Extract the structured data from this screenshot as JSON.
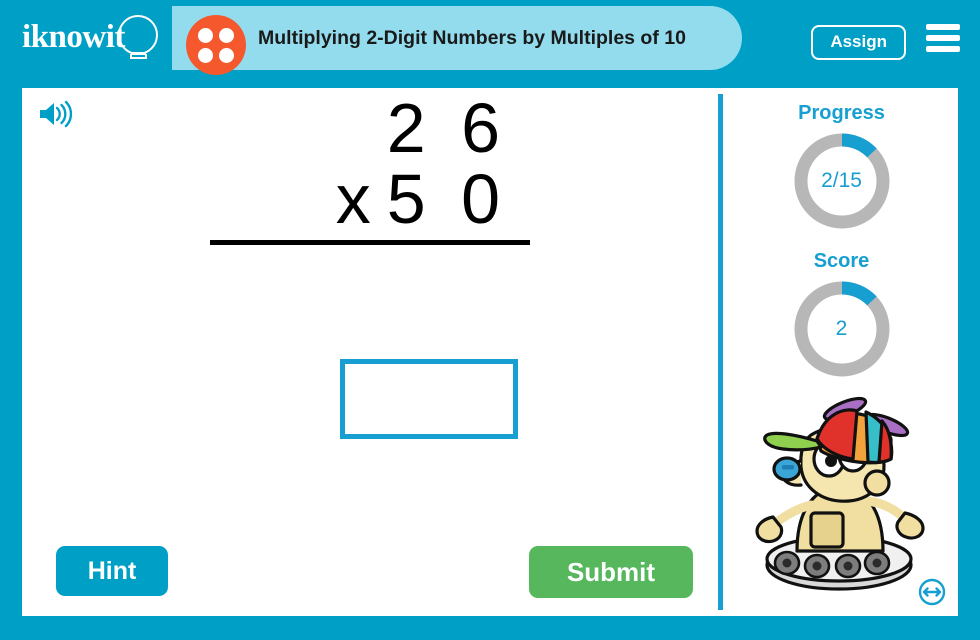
{
  "header": {
    "logo_text": "iknowit",
    "logo_icon": "lightbulb-icon",
    "lesson_icon": "four-dot-dice-icon",
    "title": "Multiplying 2-Digit Numbers by Multiples of 10",
    "assign_label": "Assign",
    "menu_icon": "hamburger-menu-icon",
    "brand_color": "#00a0c6",
    "title_pill_color": "#92dced",
    "dice_color": "#f4582c"
  },
  "main": {
    "audio_icon": "speaker-icon",
    "problem": {
      "multiplicand": "2 6",
      "operator": "x",
      "multiplier": "5 0",
      "answer_value": "",
      "answer_placeholder": ""
    },
    "hint_label": "Hint",
    "submit_label": "Submit",
    "hint_color": "#00a0c6",
    "submit_color": "#57b75c",
    "answer_border_color": "#169fd0"
  },
  "sidebar": {
    "progress": {
      "label": "Progress",
      "value": "2/15",
      "current": 2,
      "total": 15,
      "percent": 13
    },
    "score": {
      "label": "Score",
      "value": "2",
      "percent": 13
    },
    "ring_track_color": "#b7b7b7",
    "ring_fill_color": "#169fd0",
    "mascot_icon": "robot-mascot-with-propeller-cap",
    "resize_icon": "horizontal-resize-icon"
  }
}
